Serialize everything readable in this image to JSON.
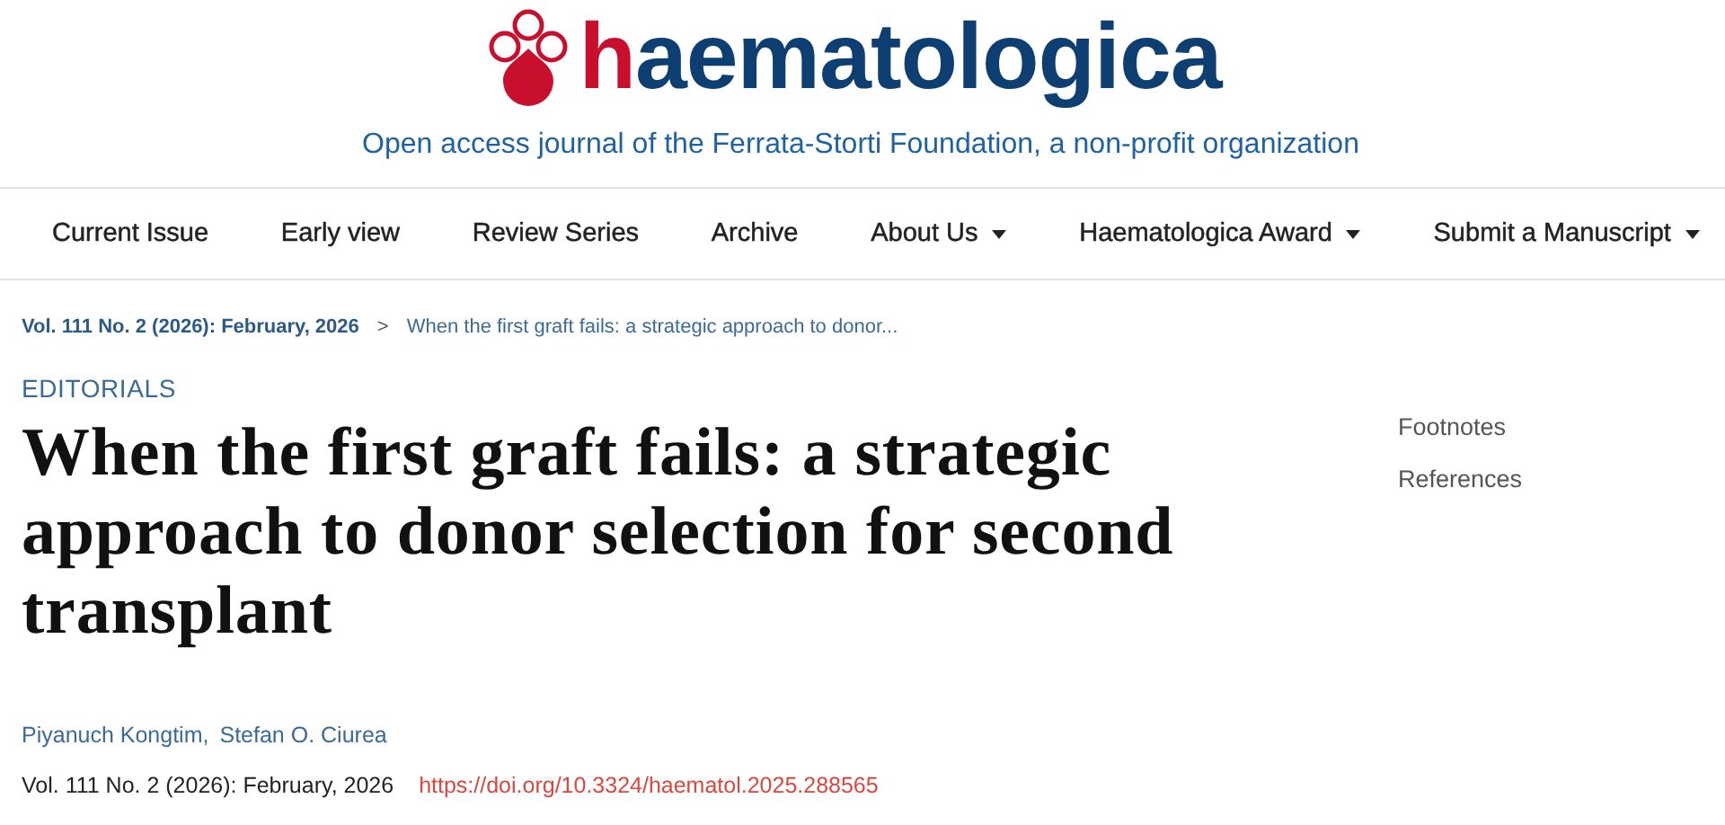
{
  "header": {
    "logo": "haematologica",
    "tagline": "Open access journal of the Ferrata-Storti Foundation, a non-profit organization"
  },
  "nav": [
    {
      "label": "Current Issue",
      "dropdown": false
    },
    {
      "label": "Early view",
      "dropdown": false
    },
    {
      "label": "Review Series",
      "dropdown": false
    },
    {
      "label": "Archive",
      "dropdown": false
    },
    {
      "label": "About Us",
      "dropdown": true
    },
    {
      "label": "Haematologica Award",
      "dropdown": true
    },
    {
      "label": "Submit a Manuscript",
      "dropdown": true
    }
  ],
  "breadcrumb": {
    "issue": "Vol. 111 No. 2 (2026): February, 2026",
    "separator": ">",
    "current": "When the first graft fails: a strategic approach to donor..."
  },
  "article": {
    "section": "EDITORIALS",
    "title": "When the first graft fails: a strategic approach to donor selection for second transplant",
    "authors": [
      "Piyanuch Kongtim",
      "Stefan O. Ciurea"
    ],
    "author_separator": ",",
    "issue": "Vol. 111 No. 2 (2026): February, 2026",
    "doi": "https://doi.org/10.3324/haematol.2025.288565"
  },
  "toc": [
    "Footnotes",
    "References"
  ]
}
